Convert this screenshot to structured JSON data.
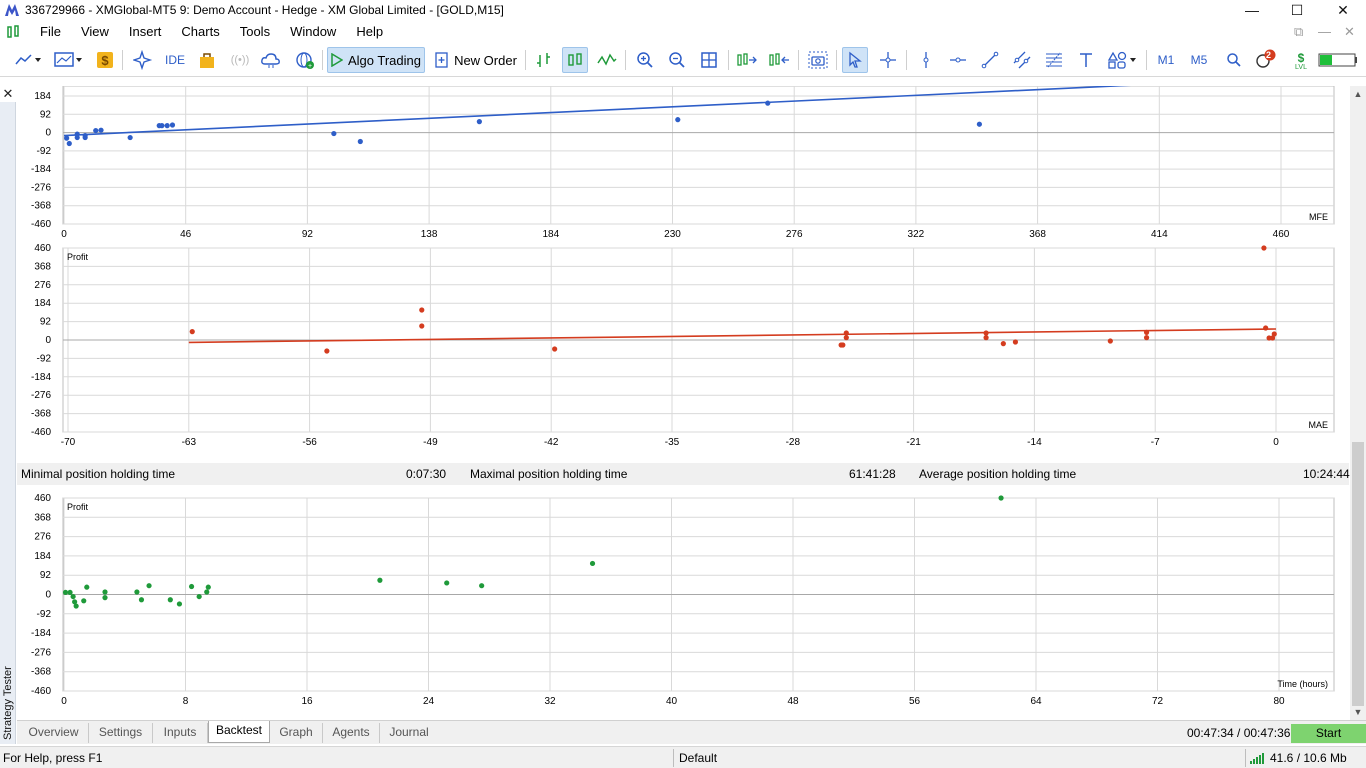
{
  "window": {
    "title": "336729966 - XMGlobal-MT5 9: Demo Account - Hedge - XM Global Limited - [GOLD,M15]",
    "minimize": "—",
    "maximize": "☐",
    "close": "✕"
  },
  "menu": {
    "items": [
      "File",
      "View",
      "Insert",
      "Charts",
      "Tools",
      "Window",
      "Help"
    ]
  },
  "toolbar": {
    "ide_label": "IDE",
    "algo_trading_label": "Algo Trading",
    "new_order_label": "New Order",
    "m1_label": "M1",
    "m5_label": "M5",
    "notification_count": "2",
    "lvl_label": "LVL"
  },
  "side_panel": {
    "label": "Strategy Tester",
    "close_glyph": "✕"
  },
  "holding_time": {
    "min_label": "Minimal position holding time",
    "min_value": "0:07:30",
    "max_label": "Maximal position holding time",
    "max_value": "61:41:28",
    "avg_label": "Average position holding time",
    "avg_value": "10:24:44"
  },
  "tabs": {
    "items": [
      "Overview",
      "Settings",
      "Inputs",
      "Backtest",
      "Graph",
      "Agents",
      "Journal"
    ],
    "selected": "Backtest",
    "timer": "00:47:34 / 00:47:36",
    "start_label": "Start"
  },
  "status": {
    "help": "For Help, press F1",
    "profile": "Default",
    "memory": "41.6 / 10.6 Mb"
  },
  "colors": {
    "mfe": "#2e5ec8",
    "mae": "#d43c1f",
    "time": "#1f9a3a",
    "grid": "#d9d9d9"
  },
  "chart_data": [
    {
      "type": "scatter",
      "xlabel": "MFE",
      "ylabel": "",
      "xlim": [
        0,
        460
      ],
      "ylim": [
        -460,
        184
      ],
      "x_ticks": [
        0,
        46,
        92,
        138,
        184,
        230,
        276,
        322,
        368,
        414,
        460
      ],
      "y_ticks": [
        184,
        92,
        0,
        -92,
        -184,
        -276,
        -368,
        -460
      ],
      "points": [
        [
          1,
          -28
        ],
        [
          2,
          -55
        ],
        [
          5,
          -25
        ],
        [
          5,
          -8
        ],
        [
          8,
          -15
        ],
        [
          8,
          -25
        ],
        [
          12,
          10
        ],
        [
          14,
          12
        ],
        [
          25,
          -25
        ],
        [
          36,
          35
        ],
        [
          37,
          35
        ],
        [
          39,
          35
        ],
        [
          41,
          38
        ],
        [
          102,
          -5
        ],
        [
          112,
          -45
        ],
        [
          157,
          55
        ],
        [
          232,
          65
        ],
        [
          266,
          148
        ],
        [
          346,
          42
        ]
      ],
      "trend": [
        [
          0,
          -15
        ],
        [
          414,
          245
        ]
      ]
    },
    {
      "type": "scatter",
      "xlabel": "MAE",
      "ylabel": "Profit",
      "xlim": [
        -70,
        0
      ],
      "ylim": [
        -460,
        460
      ],
      "x_ticks": [
        -70,
        -63,
        -56,
        -49,
        -42,
        -35,
        -28,
        -21,
        -14,
        -7,
        0
      ],
      "y_ticks": [
        460,
        368,
        276,
        184,
        92,
        0,
        -92,
        -184,
        -276,
        -368,
        -460
      ],
      "points": [
        [
          -62.8,
          42
        ],
        [
          -55,
          -55
        ],
        [
          -49.5,
          150
        ],
        [
          -49.5,
          70
        ],
        [
          -41.8,
          -45
        ],
        [
          -25.2,
          -25
        ],
        [
          -25.1,
          -25
        ],
        [
          -24.9,
          35
        ],
        [
          -24.9,
          12
        ],
        [
          -16.8,
          35
        ],
        [
          -16.8,
          12
        ],
        [
          -15.8,
          -18
        ],
        [
          -15.1,
          -10
        ],
        [
          -9.6,
          -5
        ],
        [
          -7.5,
          38
        ],
        [
          -7.5,
          12
        ],
        [
          -0.7,
          460
        ],
        [
          -0.6,
          60
        ],
        [
          -0.4,
          10
        ],
        [
          -0.2,
          10
        ],
        [
          -0.1,
          30
        ]
      ],
      "trend": [
        [
          -63,
          -12
        ],
        [
          0,
          55
        ]
      ]
    },
    {
      "type": "scatter",
      "xlabel": "Time (hours)",
      "ylabel": "Profit",
      "xlim": [
        0,
        80
      ],
      "ylim": [
        -460,
        460
      ],
      "x_ticks": [
        0,
        8,
        16,
        24,
        32,
        40,
        48,
        56,
        64,
        72,
        80
      ],
      "y_ticks": [
        460,
        368,
        276,
        184,
        92,
        0,
        -92,
        -184,
        -276,
        -368,
        -460
      ],
      "points": [
        [
          0.1,
          10
        ],
        [
          0.4,
          10
        ],
        [
          0.6,
          -10
        ],
        [
          0.7,
          -35
        ],
        [
          0.8,
          -55
        ],
        [
          1.3,
          -30
        ],
        [
          1.5,
          35
        ],
        [
          2.7,
          -15
        ],
        [
          2.7,
          12
        ],
        [
          4.8,
          12
        ],
        [
          5.1,
          -25
        ],
        [
          5.6,
          42
        ],
        [
          7.0,
          -25
        ],
        [
          7.6,
          -45
        ],
        [
          8.4,
          38
        ],
        [
          8.9,
          -10
        ],
        [
          9.4,
          12
        ],
        [
          9.5,
          35
        ],
        [
          20.8,
          68
        ],
        [
          25.2,
          55
        ],
        [
          27.5,
          42
        ],
        [
          34.8,
          148
        ],
        [
          61.7,
          460
        ]
      ]
    }
  ]
}
